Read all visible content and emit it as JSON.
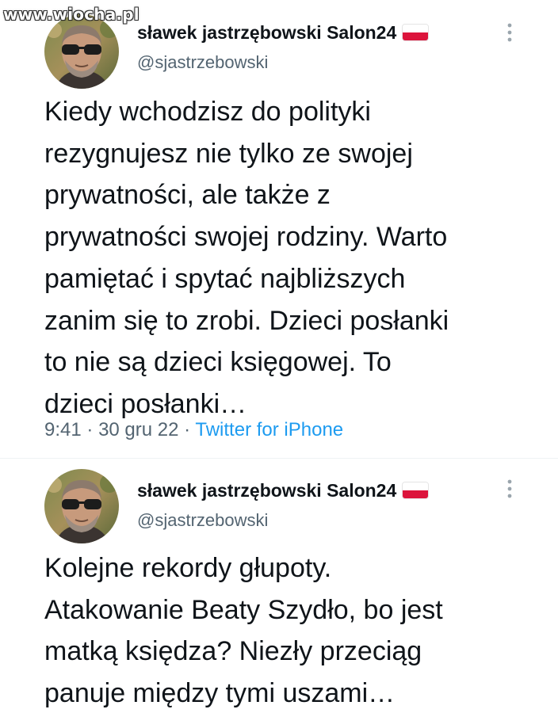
{
  "watermark": "www.wiocha.pl",
  "tweets": [
    {
      "author": {
        "display_name": "sławek jastrzębowski Salon24",
        "handle": "@sjastrzebowski",
        "flag": "poland-flag-icon"
      },
      "text": "Kiedy wchodzisz do polityki\nrezygnujesz nie tylko ze swojej\nprywatności, ale także z\nprywatności swojej rodziny. Warto\npamiętać i spytać najbliższych\nzanim się to zrobi. Dzieci posłanki\nto nie są dzieci księgowej. To\ndzieci posłanki…",
      "time": "9:41",
      "separator": "·",
      "date": "30 gru 22",
      "source": "Twitter for iPhone"
    },
    {
      "author": {
        "display_name": "sławek jastrzębowski Salon24",
        "handle": "@sjastrzebowski",
        "flag": "poland-flag-icon"
      },
      "text": "Kolejne rekordy głupoty.\nAtakowanie Beaty Szydło, bo jest\nmatką księdza? Niezły przeciąg\npanuje między tymi uszami…"
    }
  ],
  "colors": {
    "text": "#0f1419",
    "secondary": "#536471",
    "link": "#1d9bf0",
    "flag_red": "#dc143c",
    "divider": "#eff3f4"
  },
  "icons": [
    "avatar",
    "poland-flag-icon",
    "more-options-icon"
  ]
}
